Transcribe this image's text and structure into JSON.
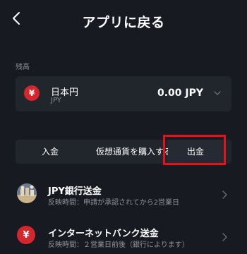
{
  "header": {
    "back_icon": "chevron-left-icon",
    "title": "アプリに戻る"
  },
  "balance": {
    "section_label": "残高",
    "currency_symbol": "¥",
    "currency_name": "日本円",
    "currency_code": "JPY",
    "amount": "0.00 JPY",
    "dropdown_icon": "chevron-down-icon"
  },
  "tabs": [
    {
      "label": "入金"
    },
    {
      "label": "仮想通貨を購入する"
    },
    {
      "label": "出金",
      "selected": true
    }
  ],
  "methods": [
    {
      "title": "JPY銀行送金",
      "subtitle": "反映時間：申請が承認されてから2営業日",
      "icon": "bank-avatar-icon"
    },
    {
      "title": "インターネットバンク送金",
      "subtitle": "反映時間：２営業日前後（銀行によります）",
      "icon": "yen-icon",
      "icon_symbol": "¥"
    }
  ],
  "colors": {
    "background": "#171a20",
    "card": "#21252c",
    "accent_red": "#d3262d",
    "highlight": "#e0141b",
    "muted_text": "#8e939c"
  }
}
